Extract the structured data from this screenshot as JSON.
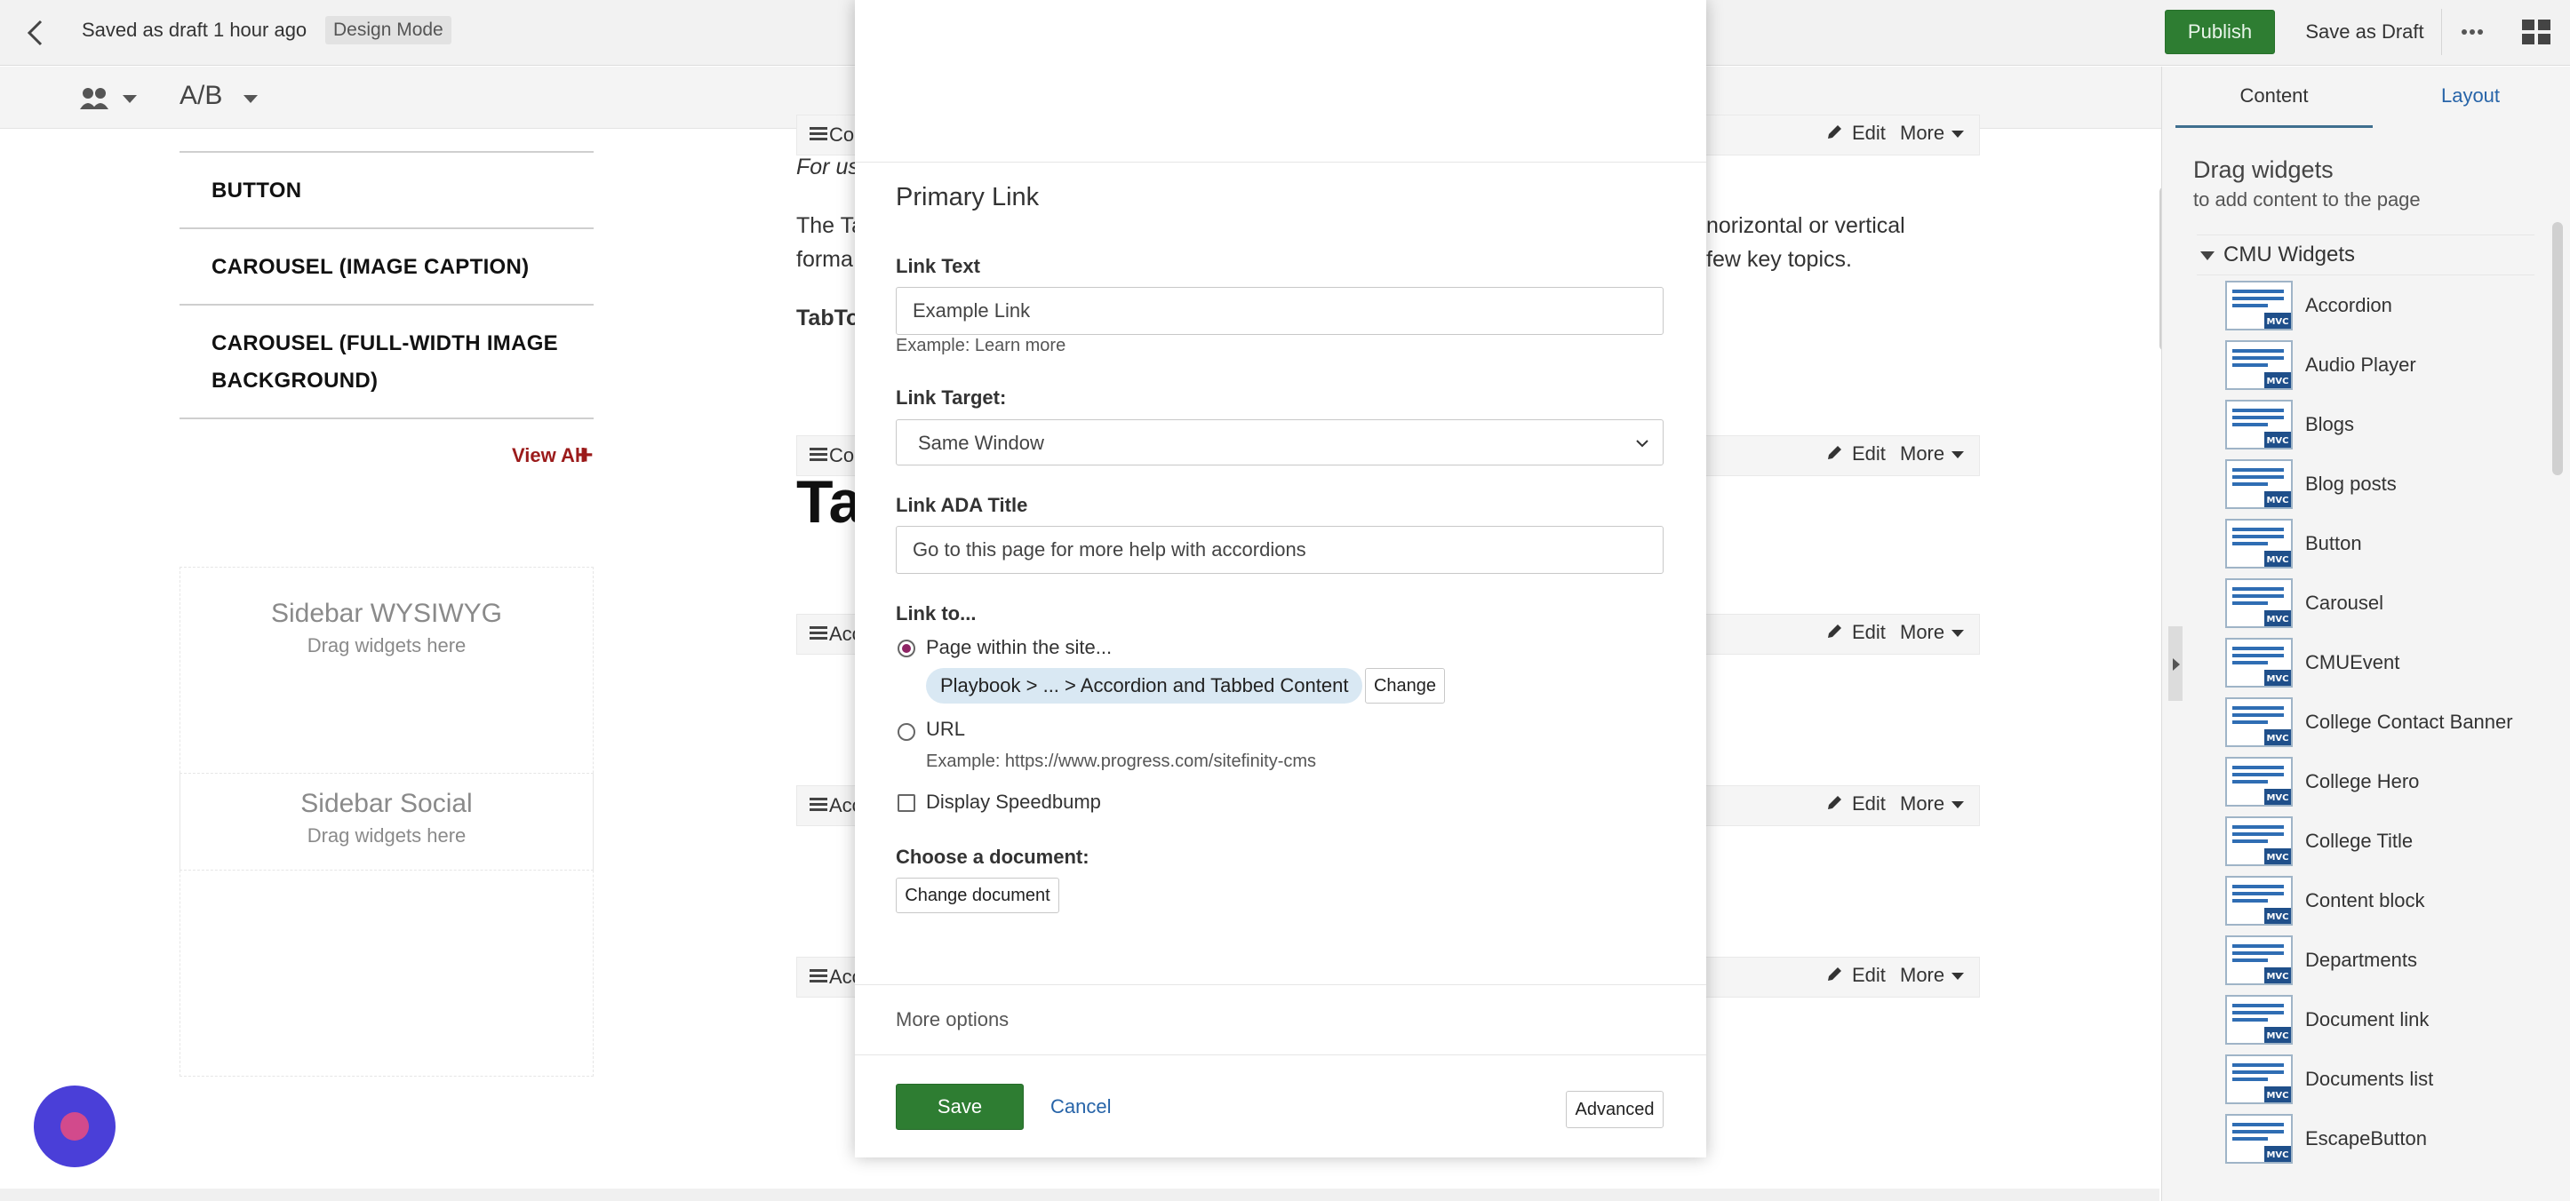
{
  "topbar": {
    "saved_text": "Saved as draft 1 hour ago",
    "mode_badge": "Design Mode",
    "publish_label": "Publish",
    "save_draft_label": "Save as Draft",
    "more_label": "···"
  },
  "toolbar": {
    "ab_label": "A/B"
  },
  "left_sidebar": {
    "items": [
      {
        "label": "BUTTON"
      },
      {
        "label": "CAROUSEL (IMAGE CAPTION)"
      },
      {
        "label": "CAROUSEL (FULL-WIDTH IMAGE BACKGROUND)"
      }
    ],
    "view_all": "View All",
    "zones": [
      {
        "title": "Sidebar WYSIWYG",
        "hint": "Drag widgets here"
      },
      {
        "title": "Sidebar Social",
        "hint": "Drag widgets here"
      }
    ]
  },
  "main": {
    "widgets": [
      {
        "name": "Co",
        "edit": "Edit",
        "more": "More"
      },
      {
        "name": "Co",
        "edit": "Edit",
        "more": "More"
      },
      {
        "name": "Acc",
        "edit": "Edit",
        "more": "More"
      },
      {
        "name": "Acc",
        "edit": "Edit",
        "more": "More"
      },
      {
        "name": "Acc",
        "edit": "Edit",
        "more": "More"
      }
    ],
    "text_italic": "For us",
    "text_line1_left": "The Ta",
    "text_line1_right": "norizontal or vertical",
    "text_line2_left": "forma",
    "text_line2_right": "few key topics.",
    "tab_heading": "TabTo",
    "big_heading": "Ta"
  },
  "right_panel": {
    "tabs": [
      "Content",
      "Layout"
    ],
    "title": "Drag widgets",
    "subtitle": "to add content to the page",
    "group": "CMU Widgets",
    "widget_badge": "MVC",
    "widgets": [
      "Accordion",
      "Audio Player",
      "Blogs",
      "Blog posts",
      "Button",
      "Carousel",
      "CMUEvent",
      "College Contact Banner",
      "College Hero",
      "College Title",
      "Content block",
      "Departments",
      "Document link",
      "Documents list",
      "EscapeButton"
    ]
  },
  "modal": {
    "title": "Primary Link",
    "link_text_label": "Link Text",
    "link_text_value": "Example Link",
    "link_text_help": "Example: Learn more",
    "link_target_label": "Link Target:",
    "link_target_value": "Same Window",
    "ada_label": "Link ADA Title",
    "ada_value": "Go to this page for more help with accordions",
    "link_to_label": "Link to...",
    "option_page": "Page within the site...",
    "page_path": "Playbook > ... > Accordion and Tabbed Content",
    "change_label": "Change",
    "option_url": "URL",
    "url_help": "Example: https://www.progress.com/sitefinity-cms",
    "speedbump_label": "Display Speedbump",
    "document_label": "Choose a document:",
    "change_document_label": "Change document",
    "more_options": "More options",
    "save_label": "Save",
    "cancel_label": "Cancel",
    "advanced_label": "Advanced"
  },
  "colors": {
    "primary_green": "#2e7d32",
    "link_blue": "#2764a8",
    "radio_accent": "#8e2464",
    "chip_bg": "#d9e8f3",
    "view_all_red": "#9b1b1b",
    "assistant_purple": "#4a3fd8"
  }
}
